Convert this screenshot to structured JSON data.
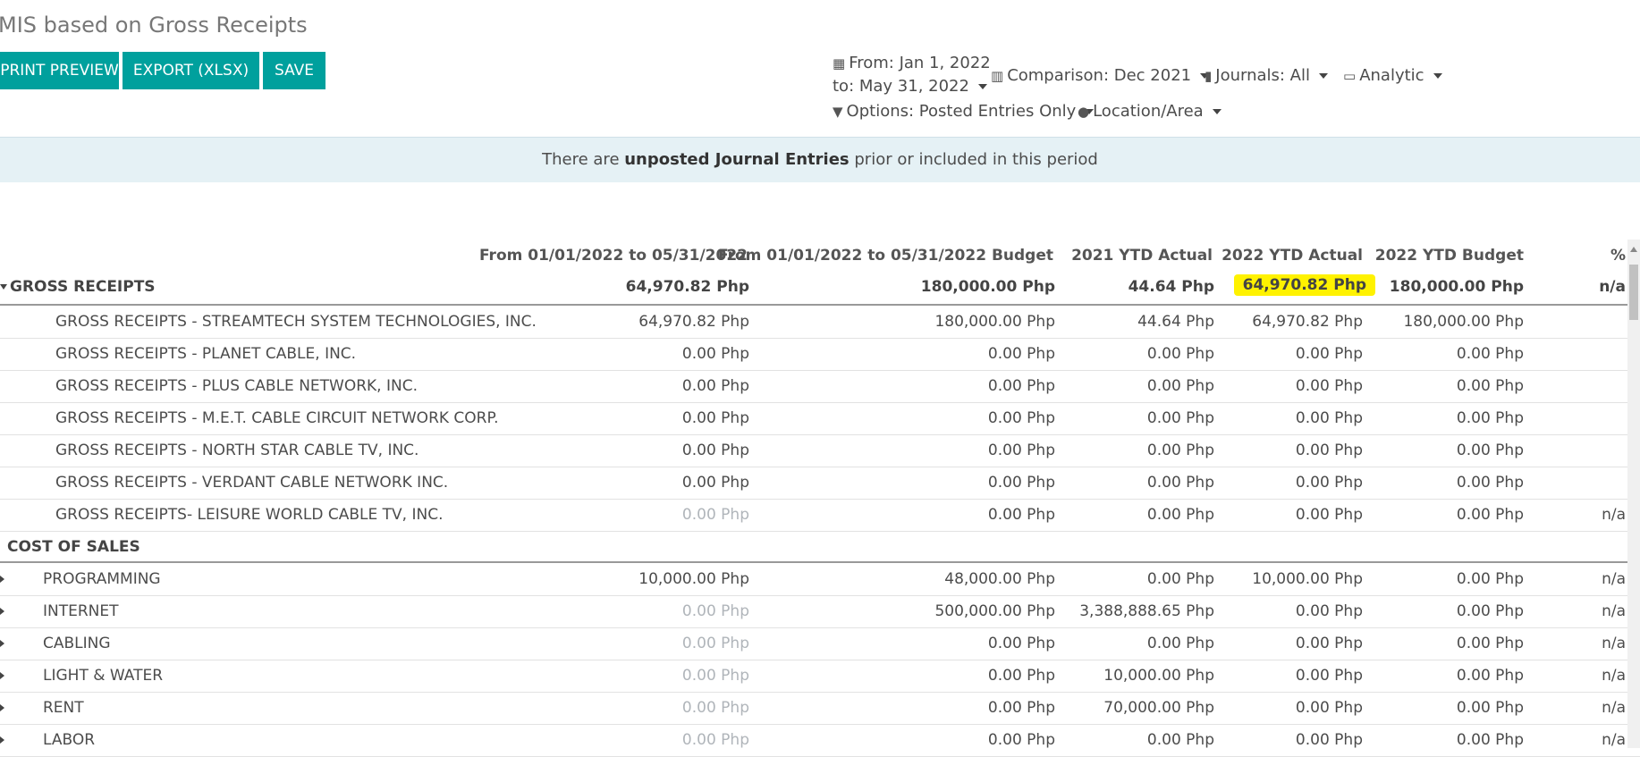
{
  "report_title": "MIS based on Gross Receipts",
  "toolbar": {
    "print_preview": "PRINT PREVIEW",
    "export": "EXPORT (XLSX)",
    "save": "SAVE"
  },
  "filters": {
    "from": "From: Jan 1, 2022",
    "to": "to: May 31, 2022",
    "comparison": "Comparison: Dec 2021",
    "journals": "Journals: All",
    "analytic": "Analytic",
    "options": "Options: Posted Entries Only",
    "location": "Location/Area"
  },
  "banner": {
    "prefix": "There are ",
    "link": "unposted Journal Entries",
    "suffix": " prior or included in this period"
  },
  "columns": [
    "From 01/01/2022 to 05/31/2022",
    "From 01/01/2022 to 05/31/2022 Budget",
    "2021 YTD Actual",
    "2022 YTD Actual",
    "2022 YTD Budget",
    "%"
  ],
  "gross_receipts": {
    "label": "GROSS RECEIPTS",
    "values": [
      "64,970.82 Php",
      "180,000.00 Php",
      "44.64 Php",
      "64,970.82 Php",
      "180,000.00 Php",
      "n/a"
    ],
    "rows": [
      {
        "label": "GROSS RECEIPTS - STREAMTECH SYSTEM TECHNOLOGIES, INC.",
        "values": [
          "64,970.82 Php",
          "180,000.00 Php",
          "44.64 Php",
          "64,970.82 Php",
          "180,000.00 Php",
          ""
        ]
      },
      {
        "label": "GROSS RECEIPTS - PLANET CABLE, INC.",
        "values": [
          "0.00 Php",
          "0.00 Php",
          "0.00 Php",
          "0.00 Php",
          "0.00 Php",
          ""
        ]
      },
      {
        "label": "GROSS RECEIPTS - PLUS CABLE NETWORK, INC.",
        "values": [
          "0.00 Php",
          "0.00 Php",
          "0.00 Php",
          "0.00 Php",
          "0.00 Php",
          ""
        ]
      },
      {
        "label": "GROSS RECEIPTS - M.E.T. CABLE CIRCUIT NETWORK CORP.",
        "values": [
          "0.00 Php",
          "0.00 Php",
          "0.00 Php",
          "0.00 Php",
          "0.00 Php",
          ""
        ]
      },
      {
        "label": "GROSS RECEIPTS - NORTH STAR CABLE TV, INC.",
        "values": [
          "0.00 Php",
          "0.00 Php",
          "0.00 Php",
          "0.00 Php",
          "0.00 Php",
          ""
        ]
      },
      {
        "label": "GROSS RECEIPTS - VERDANT CABLE NETWORK INC.",
        "values": [
          "0.00 Php",
          "0.00 Php",
          "0.00 Php",
          "0.00 Php",
          "0.00 Php",
          ""
        ]
      },
      {
        "label": "GROSS RECEIPTS- LEISURE WORLD CABLE TV, INC.",
        "values": [
          "0.00 Php",
          "0.00 Php",
          "0.00 Php",
          "0.00 Php",
          "0.00 Php",
          "n/a"
        ]
      }
    ]
  },
  "cost_of_sales": {
    "label": "COST OF SALES",
    "rows": [
      {
        "label": "PROGRAMMING",
        "values": [
          "10,000.00 Php",
          "48,000.00 Php",
          "0.00 Php",
          "10,000.00 Php",
          "0.00 Php",
          "n/a"
        ]
      },
      {
        "label": "INTERNET",
        "values": [
          "0.00 Php",
          "500,000.00 Php",
          "3,388,888.65 Php",
          "0.00 Php",
          "0.00 Php",
          "n/a"
        ]
      },
      {
        "label": "CABLING",
        "values": [
          "0.00 Php",
          "0.00 Php",
          "0.00 Php",
          "0.00 Php",
          "0.00 Php",
          "n/a"
        ]
      },
      {
        "label": "LIGHT & WATER",
        "values": [
          "0.00 Php",
          "0.00 Php",
          "10,000.00 Php",
          "0.00 Php",
          "0.00 Php",
          "n/a"
        ]
      },
      {
        "label": "RENT",
        "values": [
          "0.00 Php",
          "0.00 Php",
          "70,000.00 Php",
          "0.00 Php",
          "0.00 Php",
          "n/a"
        ]
      },
      {
        "label": "LABOR",
        "values": [
          "0.00 Php",
          "0.00 Php",
          "0.00 Php",
          "0.00 Php",
          "0.00 Php",
          "n/a"
        ]
      }
    ]
  },
  "colors": {
    "accent": "#00a09d",
    "highlight": "#fff200",
    "banner_bg": "#e5f1f5",
    "muted_zero": "#b0b5ba"
  }
}
